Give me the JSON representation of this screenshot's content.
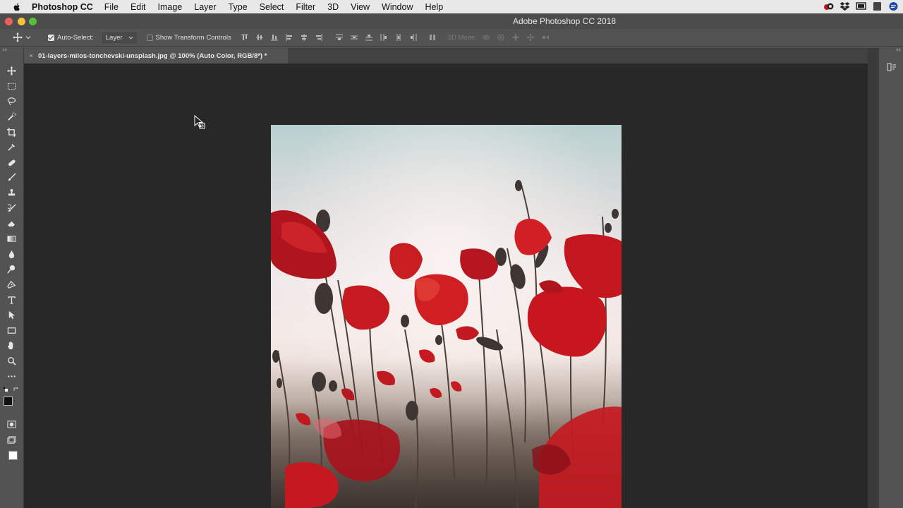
{
  "menubar": {
    "app_name": "Photoshop CC",
    "items": [
      "File",
      "Edit",
      "Image",
      "Layer",
      "Type",
      "Select",
      "Filter",
      "3D",
      "View",
      "Window",
      "Help"
    ],
    "tray_icons": [
      "creative-cloud-icon",
      "dropbox-icon",
      "airplay-icon",
      "screen-icon",
      "messages-icon"
    ]
  },
  "window": {
    "title": "Adobe Photoshop CC 2018"
  },
  "options_bar": {
    "auto_select_label": "Auto-Select:",
    "auto_select_checked": true,
    "auto_select_target": "Layer",
    "show_transform_label": "Show Transform Controls",
    "show_transform_checked": false,
    "mode_label": "3D Mode:"
  },
  "document": {
    "tab_title": "01-layers-milos-tonchevski-unsplash.jpg @ 100% (Auto Color, RGB/8*) *"
  },
  "toolbar": {
    "tools": [
      "move-tool",
      "marquee-tool",
      "lasso-tool",
      "quick-selection-tool",
      "crop-tool",
      "eyedropper-tool",
      "healing-brush-tool",
      "brush-tool",
      "clone-stamp-tool",
      "history-brush-tool",
      "eraser-tool",
      "gradient-tool",
      "blur-tool",
      "dodge-tool",
      "pen-tool",
      "type-tool",
      "path-selection-tool",
      "rectangle-tool",
      "hand-tool",
      "zoom-tool",
      "more-tools"
    ],
    "foreground_color": "#111111",
    "background_color": "#ffffff"
  },
  "colors": {
    "menubar_bg": "#e8e8e8",
    "chrome_bg": "#535353",
    "canvas_bg": "#282828",
    "accent_red": "#c8141c"
  }
}
